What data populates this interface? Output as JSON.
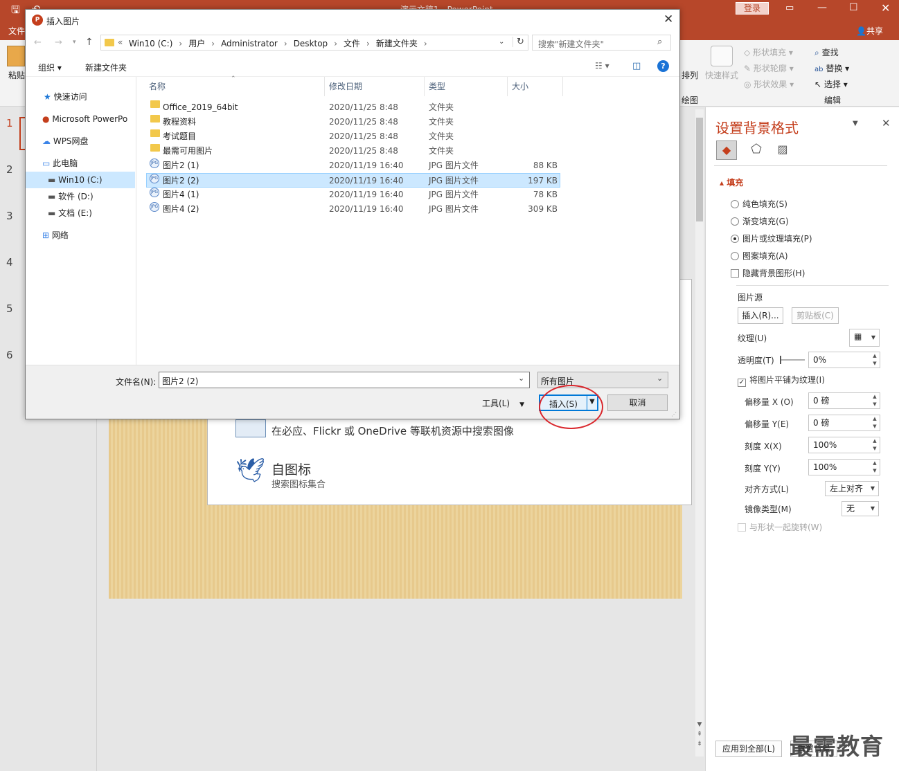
{
  "app": {
    "title": "演示文稿1 - PowerPoint",
    "login": "登录",
    "share": "共享",
    "file_tab": "文件"
  },
  "ribbon": {
    "paste": "粘贴",
    "shape_fill": "形状填充",
    "shape_outline": "形状轮廓",
    "shape_effect": "形状效果",
    "quick_style": "快速样式",
    "arrange": "排列",
    "find": "查找",
    "replace": "替换",
    "select": "选择",
    "edit_group": "编辑",
    "draw_group": "绘图"
  },
  "slides": {
    "numbers": [
      "1",
      "2",
      "3",
      "4",
      "5",
      "6"
    ]
  },
  "dialog": {
    "title": "插入图片",
    "path": [
      "Win10 (C:)",
      "用户",
      "Administrator",
      "Desktop",
      "文件",
      "新建文件夹"
    ],
    "search_placeholder": "搜索\"新建文件夹\"",
    "organize": "组织",
    "new_folder": "新建文件夹",
    "nav": [
      {
        "label": "快速访问",
        "icon": "star-icon"
      },
      {
        "label": "Microsoft PowerPo",
        "icon": "powerpoint-icon"
      },
      {
        "label": "WPS网盘",
        "icon": "cloud-icon"
      },
      {
        "label": "此电脑",
        "icon": "computer-icon"
      },
      {
        "label": "Win10 (C:)",
        "icon": "drive-icon"
      },
      {
        "label": "软件 (D:)",
        "icon": "drive-icon"
      },
      {
        "label": "文档 (E:)",
        "icon": "drive-icon"
      },
      {
        "label": "网络",
        "icon": "network-icon"
      }
    ],
    "columns": [
      "名称",
      "修改日期",
      "类型",
      "大小"
    ],
    "files": [
      {
        "name": "Office_2019_64bit",
        "date": "2020/11/25 8:48",
        "type": "文件夹",
        "size": "",
        "kind": "folder"
      },
      {
        "name": "教程资料",
        "date": "2020/11/25 8:48",
        "type": "文件夹",
        "size": "",
        "kind": "folder"
      },
      {
        "name": "考试题目",
        "date": "2020/11/25 8:48",
        "type": "文件夹",
        "size": "",
        "kind": "folder"
      },
      {
        "name": "最需可用图片",
        "date": "2020/11/25 8:48",
        "type": "文件夹",
        "size": "",
        "kind": "folder"
      },
      {
        "name": "图片2 (1)",
        "date": "2020/11/19 16:40",
        "type": "JPG 图片文件",
        "size": "88 KB",
        "kind": "jpg"
      },
      {
        "name": "图片2 (2)",
        "date": "2020/11/19 16:40",
        "type": "JPG 图片文件",
        "size": "197 KB",
        "kind": "jpg"
      },
      {
        "name": "图片4 (1)",
        "date": "2020/11/19 16:40",
        "type": "JPG 图片文件",
        "size": "78 KB",
        "kind": "jpg"
      },
      {
        "name": "图片4 (2)",
        "date": "2020/11/19 16:40",
        "type": "JPG 图片文件",
        "size": "309 KB",
        "kind": "jpg"
      }
    ],
    "filename_label": "文件名(N):",
    "filename_value": "图片2 (2)",
    "filter": "所有图片",
    "tools": "工具(L)",
    "insert": "插入(S)",
    "cancel": "取消"
  },
  "online": {
    "desc": "在必应、Flickr 或 OneDrive 等联机资源中搜索图像",
    "icons_title": "自图标",
    "icons_desc": "搜索图标集合"
  },
  "format_pane": {
    "title": "设置背景格式",
    "fill_section": "填充",
    "options": [
      "纯色填充(S)",
      "渐变填充(G)",
      "图片或纹理填充(P)",
      "图案填充(A)"
    ],
    "hide_bg": "隐藏背景图形(H)",
    "picture_source": "图片源",
    "insert_btn": "插入(R)...",
    "clipboard_btn": "剪贴板(C)",
    "texture": "纹理(U)",
    "transparency": "透明度(T)",
    "transparency_value": "0%",
    "tile": "将图片平铺为纹理(I)",
    "offset_x": "偏移量 X (O)",
    "offset_x_value": "0 磅",
    "offset_y": "偏移量 Y(E)",
    "offset_y_value": "0 磅",
    "scale_x": "刻度 X(X)",
    "scale_x_value": "100%",
    "scale_y": "刻度 Y(Y)",
    "scale_y_value": "100%",
    "align": "对齐方式(L)",
    "align_value": "左上对齐",
    "mirror": "镜像类型(M)",
    "mirror_value": "无",
    "rotate": "与形状一起旋转(W)",
    "apply_all": "应用到全部(L)",
    "reset": "重置背景"
  },
  "watermark": "最需教育"
}
